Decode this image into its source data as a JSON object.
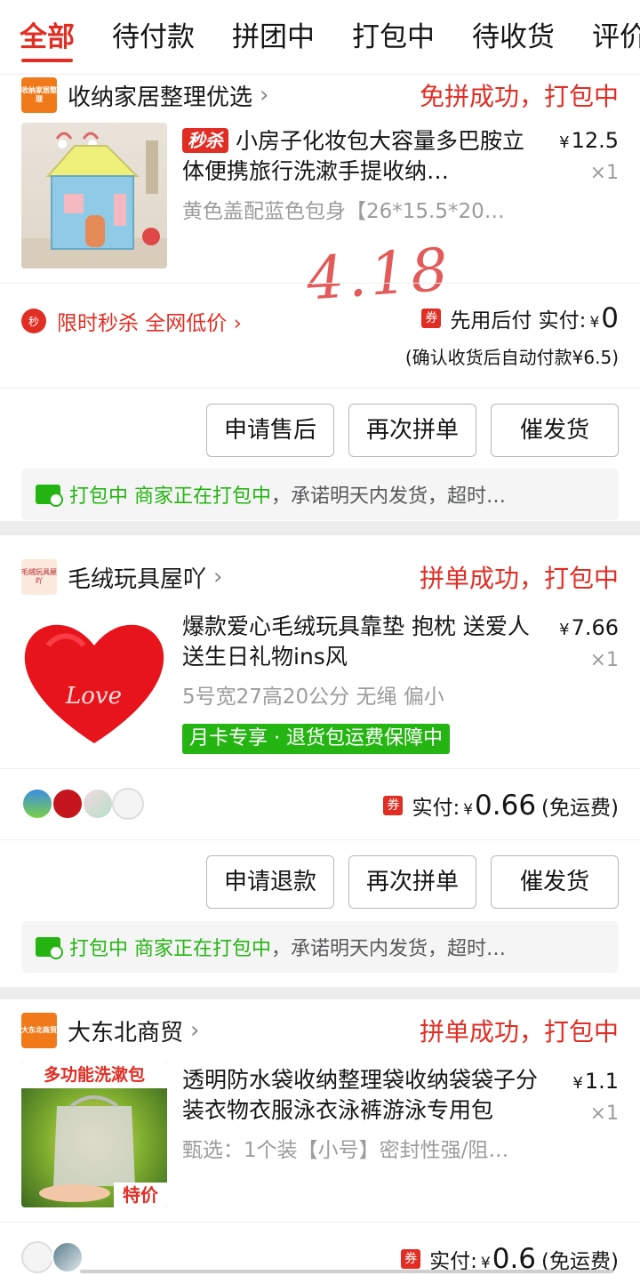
{
  "tabs": [
    "全部",
    "待付款",
    "拼团中",
    "打包中",
    "待收货",
    "评价"
  ],
  "orders": [
    {
      "shop_logo_text": "收纳家居整理",
      "shop_name": "收纳家居整理优选",
      "status": "免拼成功，打包中",
      "badge": "秒杀",
      "title": "小房子化妆包大容量多巴胺立体便携旅行洗漱手提收纳…",
      "spec": "黄色盖配蓝色包身【26*15.5*20…",
      "price": "12.5",
      "qty": "×1",
      "promo": "限时秒杀 全网低价 ›",
      "coupon": "券",
      "pay_label": "先用后付  实付:",
      "pay_yen": "¥",
      "pay_amount": "0",
      "pay_note": "(确认收货后自动付款¥6.5)",
      "buttons": [
        "申请售后",
        "再次拼单",
        "催发货"
      ],
      "tip_status": "打包中",
      "tip_green": "商家正在打包中",
      "tip_rest": "，承诺明天内发货，超时…",
      "handwriting": "4.18"
    },
    {
      "shop_logo_text": "毛绒玩具屋吖",
      "shop_name": "毛绒玩具屋吖",
      "status": "拼单成功，打包中",
      "title": "爆款爱心毛绒玩具靠垫 抱枕 送爱人 送生日礼物ins风",
      "spec": "5号宽27高20公分 无绳 偏小",
      "price": "7.66",
      "qty": "×1",
      "tag": "月卡专享 · 退货包运费保障中",
      "thumb_text": "Love",
      "coupon": "券",
      "pay_label": "实付:",
      "pay_yen": "¥",
      "pay_amount": "0.66",
      "pay_suffix": "(免运费)",
      "buttons": [
        "申请退款",
        "再次拼单",
        "催发货"
      ],
      "tip_status": "打包中",
      "tip_green": "商家正在打包中",
      "tip_rest": "，承诺明天内发货，超时…"
    },
    {
      "shop_logo_text": "大东北商贸",
      "shop_name": "大东北商贸",
      "status": "拼单成功，打包中",
      "title": "透明防水袋收纳整理袋收纳袋袋子分装衣物衣服泳衣泳裤游泳专用包",
      "spec": "甄选：1个装【小号】密封性强/阻…",
      "price": "1.1",
      "qty": "×1",
      "thumb_top": "多功能洗漱包",
      "thumb_bottom": "特价",
      "coupon": "券",
      "pay_label": "实付:",
      "pay_yen": "¥",
      "pay_amount": "0.6",
      "pay_suffix": "(免运费)"
    }
  ],
  "colors": {
    "accent": "#e02e24",
    "green": "#25b513"
  }
}
